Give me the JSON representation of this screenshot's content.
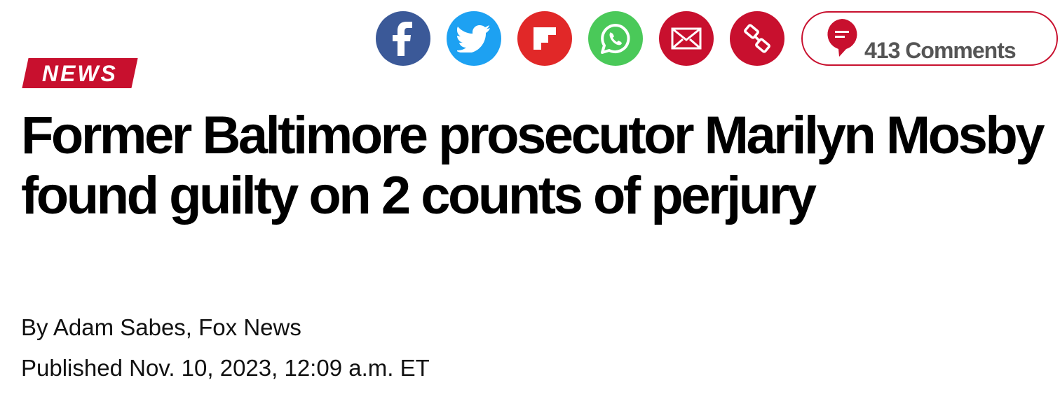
{
  "article": {
    "section_badge": "NEWS",
    "headline": "Former Baltimore prosecutor Marilyn Mosby found guilty on 2 counts of perjury",
    "byline": "By Adam Sabes, Fox News",
    "published": "Published Nov. 10, 2023, 12:09 a.m. ET"
  },
  "share": {
    "buttons": [
      {
        "name": "facebook",
        "icon": "facebook-icon",
        "color": "#3b5998"
      },
      {
        "name": "twitter",
        "icon": "twitter-bird-icon",
        "color": "#1da1f2"
      },
      {
        "name": "flipboard",
        "icon": "flipboard-icon",
        "color": "#e12828"
      },
      {
        "name": "whatsapp",
        "icon": "whatsapp-icon",
        "color": "#4ac959"
      },
      {
        "name": "email",
        "icon": "envelope-icon",
        "color": "#c8102e"
      },
      {
        "name": "copy-link",
        "icon": "link-icon",
        "color": "#c8102e"
      }
    ]
  },
  "comments": {
    "label": "413 Comments",
    "icon": "comment-bubble-icon",
    "color": "#c8102e"
  }
}
